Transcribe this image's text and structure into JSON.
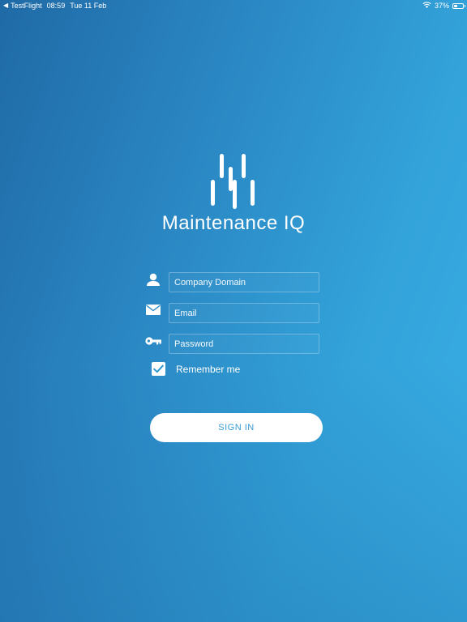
{
  "status_bar": {
    "back_app": "TestFlight",
    "time": "08:59",
    "date": "Tue 11 Feb",
    "battery": "37%",
    "battery_level": 0.37,
    "icons": [
      "back-arrow-icon",
      "wifi-icon",
      "battery-icon"
    ]
  },
  "brand": {
    "name": "Maintenance IQ",
    "logo_icon": "maintenance-iq-logo"
  },
  "form": {
    "company_domain": {
      "value": "",
      "placeholder": "Company Domain",
      "icon": "user-icon"
    },
    "email": {
      "value": "",
      "placeholder": "Email",
      "icon": "envelope-icon"
    },
    "password": {
      "value": "",
      "placeholder": "Password",
      "icon": "key-icon"
    },
    "remember_me": {
      "label": "Remember me",
      "checked": true
    }
  },
  "actions": {
    "sign_in_label": "SIGN IN"
  },
  "colors": {
    "background_start": "#1f6aa6",
    "background_end": "#39b0e6",
    "button_text": "#3a9bd3",
    "foreground": "#ffffff"
  }
}
